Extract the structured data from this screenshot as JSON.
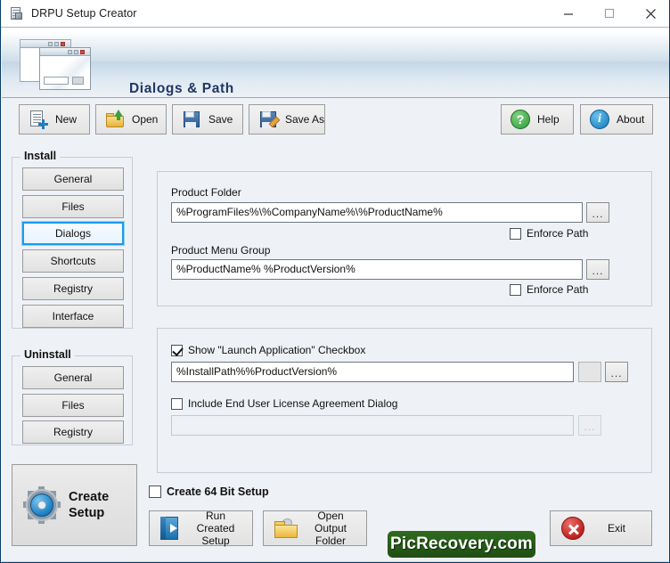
{
  "window": {
    "title": "DRPU Setup Creator",
    "icon": "setup-document-icon",
    "controls": {
      "minimize": "minimize-icon",
      "maximize": "maximize-icon",
      "close": "close-icon"
    }
  },
  "banner": {
    "title": "Dialogs & Path",
    "art": "two-dialog-windows-illustration"
  },
  "toolbar": {
    "buttons": [
      {
        "label": "New",
        "icon": "new-document-icon"
      },
      {
        "label": "Open",
        "icon": "open-folder-icon"
      },
      {
        "label": "Save",
        "icon": "floppy-save-icon"
      },
      {
        "label": "Save As",
        "icon": "floppy-pencil-save-as-icon"
      }
    ],
    "right_buttons": [
      {
        "label": "Help",
        "icon": "help-question-icon",
        "glyph": "?"
      },
      {
        "label": "About",
        "icon": "about-info-icon",
        "glyph": "i"
      }
    ]
  },
  "sidebar": {
    "install": {
      "legend": "Install",
      "items": [
        {
          "label": "General",
          "active": false
        },
        {
          "label": "Files",
          "active": false
        },
        {
          "label": "Dialogs",
          "active": true
        },
        {
          "label": "Shortcuts",
          "active": false
        },
        {
          "label": "Registry",
          "active": false
        },
        {
          "label": "Interface",
          "active": false
        }
      ]
    },
    "uninstall": {
      "legend": "Uninstall",
      "items": [
        {
          "label": "General",
          "active": false
        },
        {
          "label": "Files",
          "active": false
        },
        {
          "label": "Registry",
          "active": false
        }
      ]
    },
    "create_setup": {
      "line1": "Create",
      "line2": "Setup",
      "icon": "gear-setup-icon"
    }
  },
  "main": {
    "paths_group": {
      "product_folder": {
        "label": "Product Folder",
        "value": "%ProgramFiles%\\%CompanyName%\\%ProductName%",
        "browse_label": "...",
        "enforce": {
          "label": "Enforce Path",
          "checked": false
        }
      },
      "product_menu_group": {
        "label": "Product Menu Group",
        "value": "%ProductName% %ProductVersion%",
        "browse_label": "...",
        "enforce": {
          "label": "Enforce Path",
          "checked": false
        }
      }
    },
    "dialogs_group": {
      "launch_checkbox": {
        "label": "Show \"Launch Application\" Checkbox",
        "checked": true
      },
      "launch_value": "%InstallPath%%ProductVersion%",
      "launch_browse_label": "...",
      "eula_checkbox": {
        "label": "Include End User License Agreement Dialog",
        "checked": false
      },
      "eula_value": "",
      "eula_browse_label": "..."
    }
  },
  "footer": {
    "create_64bit": {
      "label": "Create 64 Bit Setup",
      "checked": false
    },
    "buttons": [
      {
        "line1": "Run Created",
        "line2": "Setup",
        "icon": "run-setup-icon"
      },
      {
        "line1": "Open Output",
        "line2": "Folder",
        "icon": "open-output-folder-icon"
      }
    ],
    "exit": {
      "label": "Exit",
      "icon": "exit-cross-icon"
    },
    "watermark": "PicRecovery.com"
  },
  "colors": {
    "accent_blue": "#1b9bf0",
    "banner_title": "#1f3864",
    "background": "#eef1f5",
    "watermark_green": "#2f6b1f",
    "exit_red": "#bf1f1f"
  }
}
